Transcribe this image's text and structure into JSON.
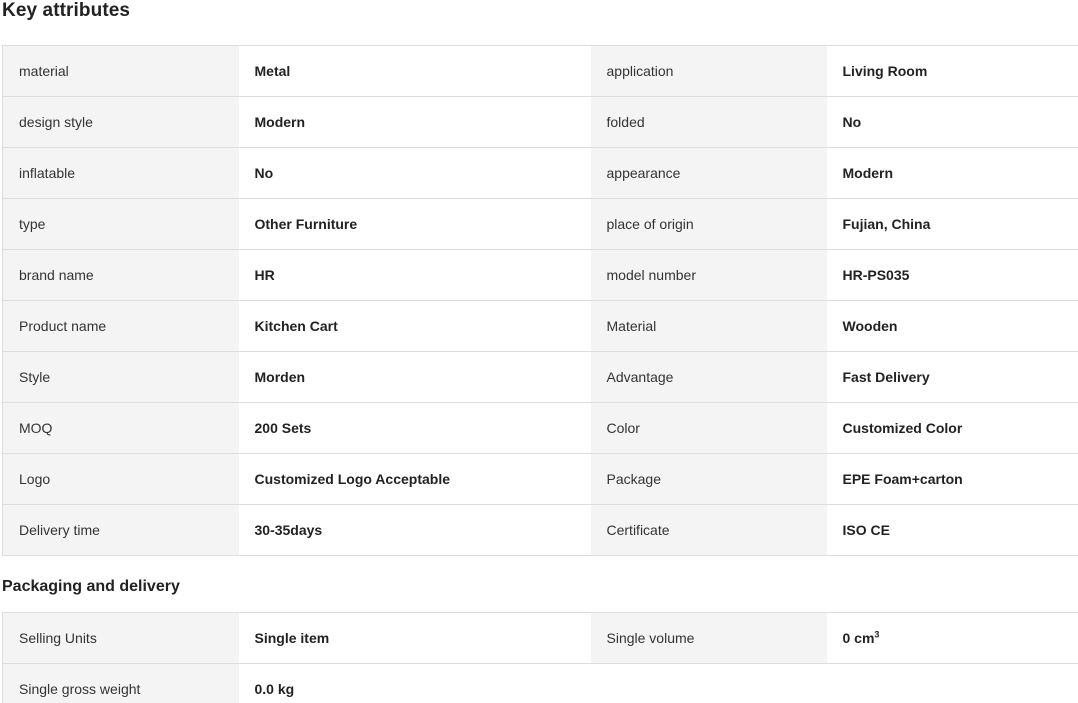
{
  "key_attributes": {
    "title": "Key attributes",
    "rows": [
      [
        {
          "label": "material",
          "value": "Metal"
        },
        {
          "label": "application",
          "value": "Living Room"
        }
      ],
      [
        {
          "label": "design style",
          "value": "Modern"
        },
        {
          "label": "folded",
          "value": "No"
        }
      ],
      [
        {
          "label": "inflatable",
          "value": "No"
        },
        {
          "label": "appearance",
          "value": "Modern"
        }
      ],
      [
        {
          "label": "type",
          "value": "Other Furniture"
        },
        {
          "label": "place of origin",
          "value": "Fujian, China"
        }
      ],
      [
        {
          "label": "brand name",
          "value": "HR"
        },
        {
          "label": "model number",
          "value": "HR-PS035"
        }
      ],
      [
        {
          "label": "Product name",
          "value": "Kitchen Cart"
        },
        {
          "label": "Material",
          "value": "Wooden"
        }
      ],
      [
        {
          "label": "Style",
          "value": "Morden"
        },
        {
          "label": "Advantage",
          "value": "Fast Delivery"
        }
      ],
      [
        {
          "label": "MOQ",
          "value": "200 Sets"
        },
        {
          "label": "Color",
          "value": "Customized Color"
        }
      ],
      [
        {
          "label": "Logo",
          "value": "Customized Logo Acceptable"
        },
        {
          "label": "Package",
          "value": "EPE Foam+carton"
        }
      ],
      [
        {
          "label": "Delivery time",
          "value": "30-35days"
        },
        {
          "label": "Certificate",
          "value": "ISO CE"
        }
      ]
    ]
  },
  "packaging_delivery": {
    "title": "Packaging and delivery",
    "selling_units_label": "Selling Units",
    "selling_units_value": "Single item",
    "single_volume_label": "Single volume",
    "single_volume_value": "0 cm",
    "single_volume_unit_sup": "3",
    "gross_weight_label": "Single gross weight",
    "gross_weight_value": "0.0 kg"
  }
}
